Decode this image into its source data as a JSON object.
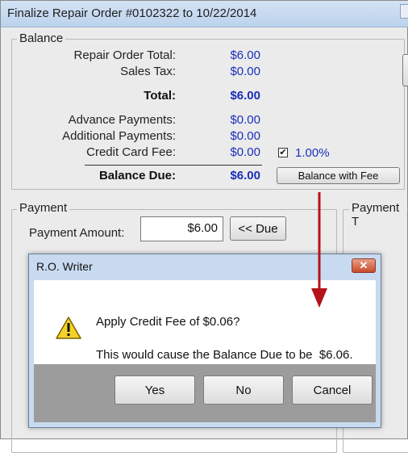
{
  "window": {
    "title": "Finalize Repair Order #0102322 to 10/22/2014"
  },
  "balance": {
    "group_label": "Balance",
    "ro_total_label": "Repair Order Total:",
    "ro_total_value": "$6.00",
    "sales_tax_label": "Sales Tax:",
    "sales_tax_value": "$0.00",
    "total_label": "Total:",
    "total_value": "$6.00",
    "advance_label": "Advance Payments:",
    "advance_value": "$0.00",
    "additional_label": "Additional Payments:",
    "additional_value": "$0.00",
    "cc_fee_label": "Credit Card Fee:",
    "cc_fee_value": "$0.00",
    "fee_checked": true,
    "fee_percent": "1.00%",
    "balance_due_label": "Balance Due:",
    "balance_due_value": "$6.00",
    "balance_with_fee_label": "Balance with Fee"
  },
  "payment": {
    "group_label": "Payment",
    "amount_label": "Payment Amount:",
    "amount_value": "$6.00",
    "due_button_label": "<< Due",
    "payment_type_label": "Payment T"
  },
  "dialog": {
    "title": "R.O. Writer",
    "close_glyph": "✕",
    "icon": "warning-icon",
    "line1": "Apply Credit Fee of $0.06?",
    "line2": "This would cause the Balance Due to be  $6.06.",
    "yes_label": "Yes",
    "no_label": "No",
    "cancel_label": "Cancel"
  },
  "colors": {
    "value_blue": "#1a2fb8",
    "arrow_red": "#b5121b",
    "dialog_frame": "#c8daf0"
  }
}
